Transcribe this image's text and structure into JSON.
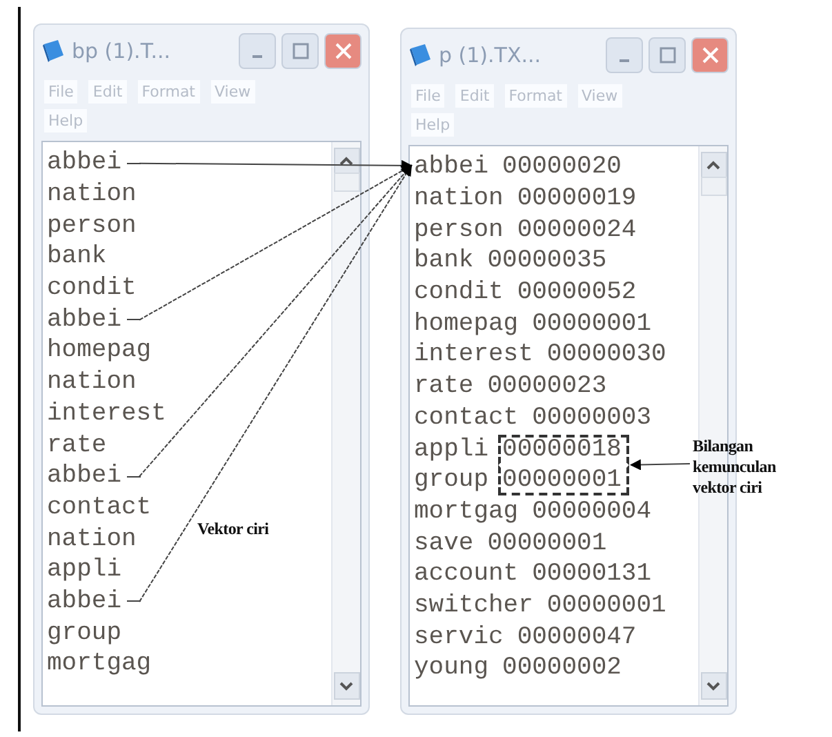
{
  "windows": [
    {
      "title": "bp (1).T...",
      "menu": [
        "File",
        "Edit",
        "Format",
        "View",
        "Help"
      ],
      "rows": [
        {
          "word": "abbei",
          "arrow": true
        },
        {
          "word": "nation",
          "arrow": false
        },
        {
          "word": "person",
          "arrow": false
        },
        {
          "word": "bank",
          "arrow": false
        },
        {
          "word": "condit",
          "arrow": false
        },
        {
          "word": "abbei",
          "arrow": true
        },
        {
          "word": "homepag",
          "arrow": false
        },
        {
          "word": "nation",
          "arrow": false
        },
        {
          "word": "interest",
          "arrow": false
        },
        {
          "word": "rate",
          "arrow": false
        },
        {
          "word": "abbei",
          "arrow": true
        },
        {
          "word": "contact",
          "arrow": false
        },
        {
          "word": "nation",
          "arrow": false
        },
        {
          "word": "appli",
          "arrow": false
        },
        {
          "word": "abbei",
          "arrow": true
        },
        {
          "word": "group",
          "arrow": false
        },
        {
          "word": "mortgag",
          "arrow": false
        }
      ]
    },
    {
      "title": "p (1).TX...",
      "menu": [
        "File",
        "Edit",
        "Format",
        "View",
        "Help"
      ],
      "rows": [
        {
          "word": "abbei",
          "count": "00000020",
          "boxed": false
        },
        {
          "word": "nation",
          "count": "00000019",
          "boxed": false
        },
        {
          "word": "person",
          "count": "00000024",
          "boxed": false
        },
        {
          "word": "bank",
          "count": "00000035",
          "boxed": false
        },
        {
          "word": "condit",
          "count": "00000052",
          "boxed": false
        },
        {
          "word": "homepag",
          "count": "00000001",
          "boxed": false
        },
        {
          "word": "interest",
          "count": "00000030",
          "boxed": false
        },
        {
          "word": "rate",
          "count": "00000023",
          "boxed": false
        },
        {
          "word": "contact",
          "count": "00000003",
          "boxed": false
        },
        {
          "word": "appli",
          "count": "00000018",
          "boxed": true
        },
        {
          "word": "group",
          "count": "00000001",
          "boxed": true
        },
        {
          "word": "mortgag",
          "count": "00000004",
          "boxed": false
        },
        {
          "word": "save",
          "count": "00000001",
          "boxed": false
        },
        {
          "word": "account",
          "count": "00000131",
          "boxed": false
        },
        {
          "word": "switcher",
          "count": "00000001",
          "boxed": false
        },
        {
          "word": "servic",
          "count": "00000047",
          "boxed": false
        },
        {
          "word": "young",
          "count": "00000002",
          "boxed": false
        }
      ]
    }
  ],
  "annotations": [
    {
      "text": "Vektor ciri"
    },
    {
      "text": "Bilangan kemunculan vektor ciri"
    }
  ]
}
